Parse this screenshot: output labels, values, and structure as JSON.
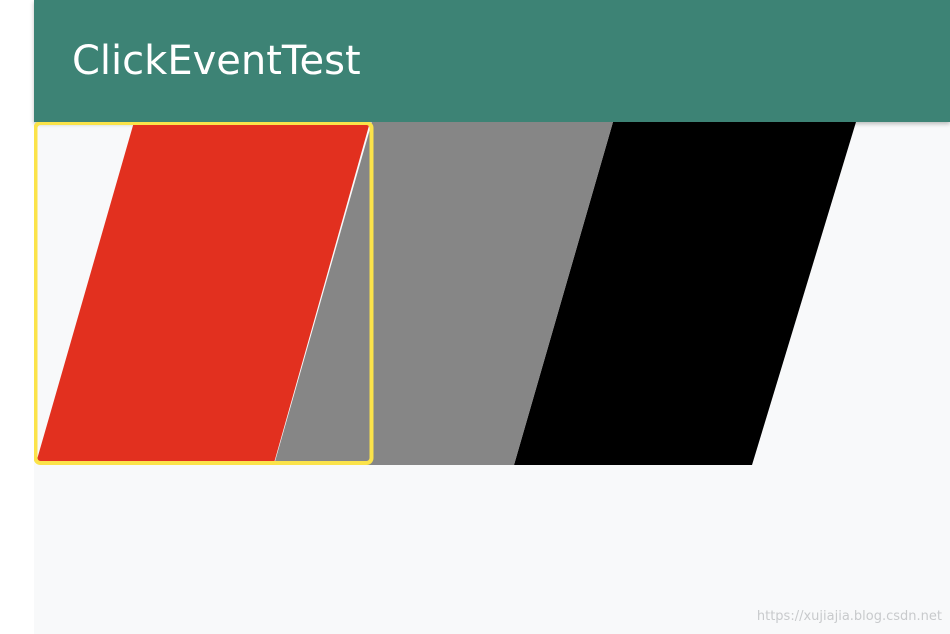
{
  "app_bar": {
    "title": "ClickEventTest",
    "color": "#3d8375"
  },
  "views": [
    {
      "name": "red-skewed-view",
      "color": "#e2301f",
      "selected": true
    },
    {
      "name": "gray-skewed-view",
      "color": "#868686",
      "selected": false
    },
    {
      "name": "black-skewed-view",
      "color": "#000000",
      "selected": false
    }
  ],
  "selection_highlight_color": "#fbe34a",
  "watermark": "https://xujiajia.blog.csdn.net"
}
